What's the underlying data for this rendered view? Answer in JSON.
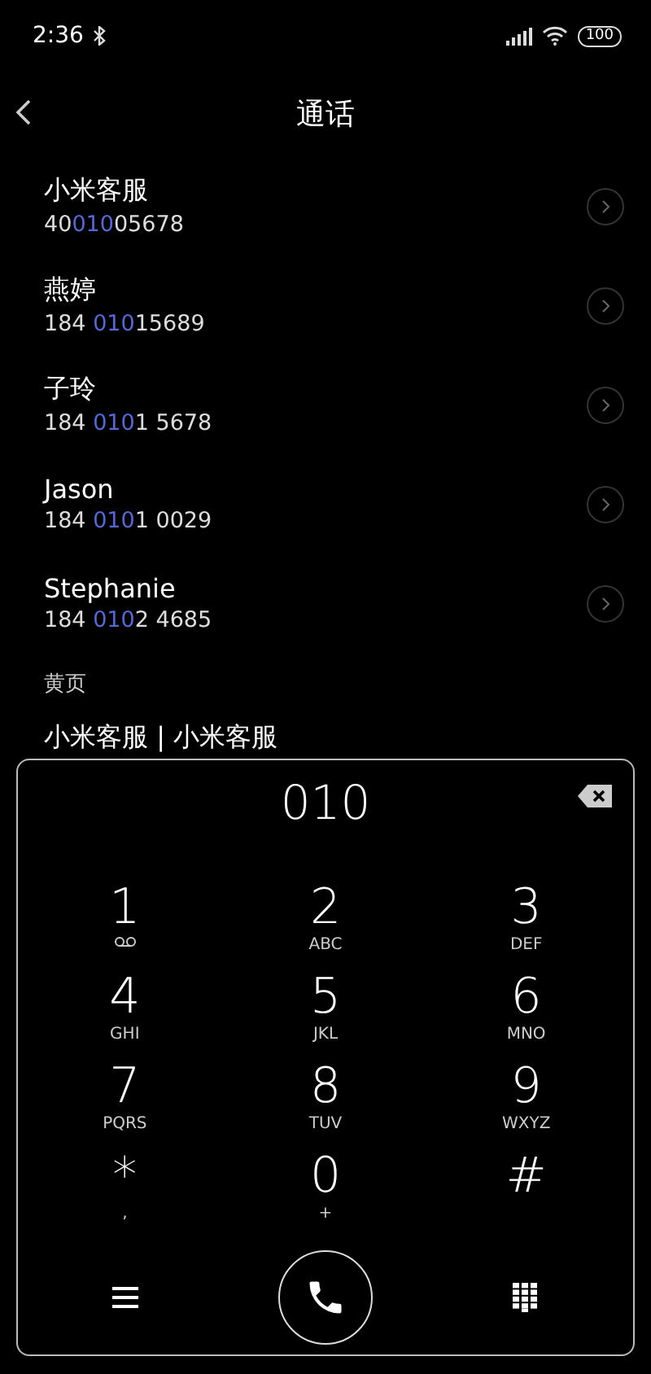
{
  "status_bar": {
    "time": "2:36",
    "battery": "100"
  },
  "header": {
    "title": "通话"
  },
  "contacts": [
    {
      "name": "小米客服",
      "number": [
        {
          "text": "40",
          "match": false
        },
        {
          "text": "010",
          "match": true
        },
        {
          "text": "05678",
          "match": false
        }
      ]
    },
    {
      "name": "燕婷",
      "number": [
        {
          "text": "184 ",
          "match": false
        },
        {
          "text": "010",
          "match": true
        },
        {
          "text": "15689",
          "match": false
        }
      ]
    },
    {
      "name": "子玲",
      "number": [
        {
          "text": "184 ",
          "match": false
        },
        {
          "text": "010",
          "match": true
        },
        {
          "text": "1 5678",
          "match": false
        }
      ]
    },
    {
      "name": "Jason",
      "number": [
        {
          "text": "184 ",
          "match": false
        },
        {
          "text": "010",
          "match": true
        },
        {
          "text": "1 0029",
          "match": false
        }
      ]
    },
    {
      "name": "Stephanie",
      "number": [
        {
          "text": "184 ",
          "match": false
        },
        {
          "text": "010",
          "match": true
        },
        {
          "text": "2 4685",
          "match": false
        }
      ]
    }
  ],
  "section": {
    "title": "黄页",
    "items": [
      {
        "name": "小米客服 | 小米客服"
      }
    ]
  },
  "dialpad": {
    "input": "010",
    "keys": [
      {
        "digit": "1",
        "kind": "voicemail"
      },
      {
        "digit": "2",
        "kind": "letters",
        "sub": "ABC"
      },
      {
        "digit": "3",
        "kind": "letters",
        "sub": "DEF"
      },
      {
        "digit": "4",
        "kind": "letters",
        "sub": "GHI"
      },
      {
        "digit": "5",
        "kind": "letters",
        "sub": "JKL"
      },
      {
        "digit": "6",
        "kind": "letters",
        "sub": "MNO"
      },
      {
        "digit": "7",
        "kind": "letters",
        "sub": "PQRS"
      },
      {
        "digit": "8",
        "kind": "letters",
        "sub": "TUV"
      },
      {
        "digit": "9",
        "kind": "letters",
        "sub": "WXYZ"
      },
      {
        "digit": "*",
        "kind": "letters",
        "sub": ","
      },
      {
        "digit": "0",
        "kind": "letters",
        "sub": "+"
      },
      {
        "digit": "#",
        "kind": "letters"
      }
    ]
  }
}
